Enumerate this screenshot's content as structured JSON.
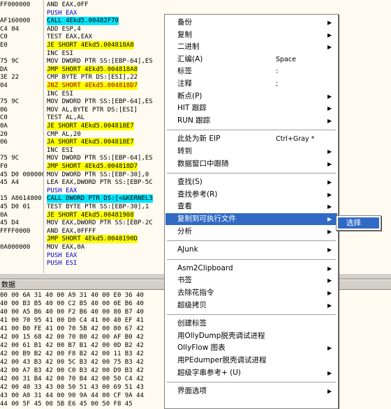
{
  "disasm": {
    "rows": [
      {
        "addr": "FF000000",
        "code": "AND EAX,0FF",
        "hl": "none"
      },
      {
        "addr": "",
        "code": "PUSH EAX",
        "hl": "none"
      },
      {
        "addr": "AF160000",
        "code": "CALL 4Ekd5.00482F70",
        "hl": "cyan"
      },
      {
        "addr": "C4 04",
        "code": "ADD ESP,4",
        "hl": "none"
      },
      {
        "addr": "C0",
        "code": "TEST EAX,EAX",
        "hl": "none"
      },
      {
        "addr": "E0",
        "code": "JE SHORT 4Ekd5.004818A8",
        "hl": "yellow"
      },
      {
        "addr": "",
        "code": "INC ESI",
        "hl": "none"
      },
      {
        "addr": "75 9C",
        "code": "MOV DWORD PTR SS:[EBP-64],ES",
        "hl": "none"
      },
      {
        "addr": "DA",
        "code": "JMP SHORT 4Ekd5.004818A8",
        "hl": "yellow"
      },
      {
        "addr": "3E 22",
        "code": "CMP BYTE PTR DS:[ESI],22",
        "hl": "none"
      },
      {
        "addr": "04",
        "code": "JNZ SHORT 4Ekd5.004818D7",
        "hl": "yellow"
      },
      {
        "addr": "",
        "code": "INC ESI",
        "hl": "none"
      },
      {
        "addr": "75 9C",
        "code": "MOV DWORD PTR SS:[EBP-64],ES",
        "hl": "none"
      },
      {
        "addr": "06",
        "code": "MOV AL,BYTE PTR DS:[ESI]",
        "hl": "none"
      },
      {
        "addr": "C0",
        "code": "TEST AL,AL",
        "hl": "none"
      },
      {
        "addr": "0A",
        "code": "JE SHORT 4Ekd5.004818E7",
        "hl": "yellow"
      },
      {
        "addr": "20",
        "code": "CMP AL,20",
        "hl": "none"
      },
      {
        "addr": "06",
        "code": "JA SHORT 4Ekd5.004818E7",
        "hl": "yellow"
      },
      {
        "addr": "",
        "code": "INC ESI",
        "hl": "none"
      },
      {
        "addr": "75 9C",
        "code": "MOV DWORD PTR SS:[EBP-64],ES",
        "hl": "none"
      },
      {
        "addr": "F0",
        "code": "JMP SHORT 4Ekd5.004818D7",
        "hl": "yellow"
      },
      {
        "addr": "45 D0 00000000",
        "code": "MOV DWORD PTR SS:[EBP-30],0",
        "hl": "none"
      },
      {
        "addr": "45 A4",
        "code": "LEA EAX,DWORD PTR SS:[EBP-5C",
        "hl": "none"
      },
      {
        "addr": "",
        "code": "PUSH EAX",
        "hl": "none"
      },
      {
        "addr": "15 A8614800",
        "code": "CALL DWORD PTR DS:[<&KERNEL3",
        "hl": "cyan"
      },
      {
        "addr": "45 D0 01",
        "code": "TEST BYTE PTR SS:[EBP-30],1",
        "hl": "none"
      },
      {
        "addr": "0A",
        "code": "JE SHORT 4Ekd5.00481908",
        "hl": "yellow"
      },
      {
        "addr": "45 D4",
        "code": "MOV EAX,DWORD PTR SS:[EBP-2C",
        "hl": "none"
      },
      {
        "addr": "FFFF0000",
        "code": "AND EAX,0FFFF",
        "hl": "none"
      },
      {
        "addr": "",
        "code": "JMP SHORT 4Ekd5.0048190D",
        "hl": "yellow"
      },
      {
        "addr": "0A000000",
        "code": "MOV EAX,0A",
        "hl": "none"
      },
      {
        "addr": "",
        "code": "PUSH EAX",
        "hl": "none"
      },
      {
        "addr": "",
        "code": "PUSH ESI",
        "hl": "none"
      }
    ]
  },
  "dump": {
    "title": "数据",
    "rows": [
      "00 00 6A 31 40 00 A9 31 40 00 E0 36 40",
      "40 00 B3 B5 40 00 C2 B5 40 00 0E B6 40",
      "40 00 A5 B6 40 00 F2 B6 40 00 80 B7 40",
      "41 00 70 95 41 00 D0 C4 41 00 40 EF 41",
      "41 00 B0 FE 41 00 70 5B 42 00 80 67 42",
      "42 00 15 68 42 00 70 B0 42 00 AF B0 42",
      "42 00 61 B1 42 00 B7 B1 42 00 0D B2 42",
      "42 00 B9 B2 42 00 F8 B2 42 00 11 B3 42",
      "42 00 43 B3 42 00 5C B3 42 00 75 B3 42",
      "42 00 A7 B3 42 00 C0 B3 42 00 D9 B3 42",
      "42 00 31 B4 42 00 70 B4 42 00 50 C4 42",
      "42 00 40 33 43 00 50 51 43 00 69 51 43",
      "43 00 A0 31 44 00 90 9A 44 00 CF 9A 44",
      "44 00 5F 45 00 5B E6 45 00 50 F8 45"
    ]
  },
  "menu": {
    "groups": [
      [
        {
          "label": "备份",
          "sc": "",
          "sub": true
        },
        {
          "label": "复制",
          "sc": "",
          "sub": true
        },
        {
          "label": "二进制",
          "sc": "",
          "sub": true
        },
        {
          "label": "汇编(A)",
          "sc": "Space",
          "sub": false
        },
        {
          "label": "标签",
          "sc": ":",
          "sub": false
        },
        {
          "label": "注释",
          "sc": ";",
          "sub": false
        },
        {
          "label": "断点(P)",
          "sc": "",
          "sub": true
        },
        {
          "label": "HIT 跟踪",
          "sc": "",
          "sub": true
        },
        {
          "label": "RUN 跟踪",
          "sc": "",
          "sub": true
        }
      ],
      [
        {
          "label": "此处为新 EIP",
          "sc": "Ctrl+Gray *",
          "sub": false
        },
        {
          "label": "转到",
          "sc": "",
          "sub": true
        },
        {
          "label": "数据窗口中跟随",
          "sc": "",
          "sub": true
        }
      ],
      [
        {
          "label": "查找(S)",
          "sc": "",
          "sub": true
        },
        {
          "label": "查找参考(R)",
          "sc": "",
          "sub": true
        },
        {
          "label": "查看",
          "sc": "",
          "sub": true
        },
        {
          "label": "复制到可执行文件",
          "sc": "",
          "sub": true,
          "active": true
        },
        {
          "label": "分析",
          "sc": "",
          "sub": true
        }
      ],
      [
        {
          "label": "AJunk",
          "sc": "",
          "sub": true
        }
      ],
      [
        {
          "label": "Asm2Clipboard",
          "sc": "",
          "sub": true
        },
        {
          "label": "书签",
          "sc": "",
          "sub": true
        },
        {
          "label": "去除花指令",
          "sc": "",
          "sub": true
        },
        {
          "label": "超级拷贝",
          "sc": "",
          "sub": true
        }
      ],
      [
        {
          "label": "创建标签",
          "sc": "",
          "sub": false
        },
        {
          "label": "用OllyDump脱壳调试进程",
          "sc": "",
          "sub": false
        },
        {
          "label": "OllyFlow 图表",
          "sc": "",
          "sub": true
        },
        {
          "label": "用PEdumper脱壳调试进程",
          "sc": "",
          "sub": false
        },
        {
          "label": "超级字串参考+ (U)",
          "sc": "",
          "sub": true
        }
      ],
      [
        {
          "label": "界面选项",
          "sc": "",
          "sub": true
        }
      ]
    ],
    "submenu": {
      "label": "选择"
    }
  },
  "colors": {
    "accent": "#316ac5",
    "jump_highlight": "#ffff00",
    "call_highlight": "#00e5ff",
    "background": "#fffbf0"
  }
}
